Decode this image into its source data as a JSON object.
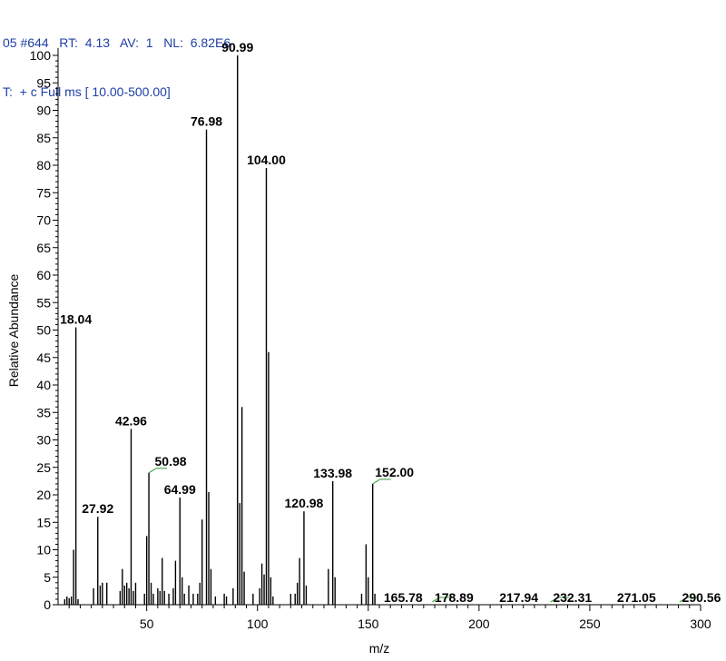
{
  "header": {
    "line1": "05 #644   RT:  4.13   AV:  1   NL:  6.82E6",
    "line2": "T:  + c Full ms [ 10.00-500.00]"
  },
  "colors": {
    "header_text": "#1f3fa6",
    "label_leader": "#2e9b2e",
    "axis": "#000000"
  },
  "chart_data": {
    "type": "bar",
    "xlabel": "m/z",
    "ylabel": "Relative Abundance",
    "xlim": [
      10,
      300
    ],
    "ylim": [
      0,
      100
    ],
    "x_ticks": [
      50,
      100,
      150,
      200,
      250,
      300
    ],
    "y_ticks": [
      0,
      5,
      10,
      15,
      20,
      25,
      30,
      35,
      40,
      45,
      50,
      55,
      60,
      65,
      70,
      75,
      80,
      85,
      90,
      95,
      100
    ],
    "peaks": [
      {
        "mz": 13.0,
        "value": 1.0
      },
      {
        "mz": 14.0,
        "value": 1.5
      },
      {
        "mz": 15.0,
        "value": 1.2
      },
      {
        "mz": 16.0,
        "value": 1.5
      },
      {
        "mz": 17.0,
        "value": 10.0
      },
      {
        "mz": 18.04,
        "value": 50.5
      },
      {
        "mz": 19.0,
        "value": 1.0
      },
      {
        "mz": 26.0,
        "value": 3.0
      },
      {
        "mz": 27.92,
        "value": 16.0
      },
      {
        "mz": 29.0,
        "value": 3.5
      },
      {
        "mz": 30.0,
        "value": 4.0
      },
      {
        "mz": 32.0,
        "value": 4.0
      },
      {
        "mz": 38.0,
        "value": 2.5
      },
      {
        "mz": 39.0,
        "value": 6.5
      },
      {
        "mz": 40.0,
        "value": 3.5
      },
      {
        "mz": 41.0,
        "value": 4.0
      },
      {
        "mz": 42.0,
        "value": 3.0
      },
      {
        "mz": 42.96,
        "value": 32.0
      },
      {
        "mz": 44.0,
        "value": 2.5
      },
      {
        "mz": 45.0,
        "value": 4.0
      },
      {
        "mz": 49.0,
        "value": 2.0
      },
      {
        "mz": 50.0,
        "value": 12.5
      },
      {
        "mz": 50.98,
        "value": 24.0
      },
      {
        "mz": 52.0,
        "value": 4.0
      },
      {
        "mz": 53.0,
        "value": 2.0
      },
      {
        "mz": 55.0,
        "value": 3.0
      },
      {
        "mz": 56.0,
        "value": 2.5
      },
      {
        "mz": 57.0,
        "value": 8.5
      },
      {
        "mz": 58.0,
        "value": 2.5
      },
      {
        "mz": 60.0,
        "value": 2.0
      },
      {
        "mz": 62.0,
        "value": 3.0
      },
      {
        "mz": 63.0,
        "value": 8.0
      },
      {
        "mz": 64.99,
        "value": 19.5
      },
      {
        "mz": 66.0,
        "value": 5.0
      },
      {
        "mz": 67.0,
        "value": 2.0
      },
      {
        "mz": 69.0,
        "value": 3.5
      },
      {
        "mz": 71.0,
        "value": 2.0
      },
      {
        "mz": 73.0,
        "value": 2.0
      },
      {
        "mz": 74.0,
        "value": 4.0
      },
      {
        "mz": 75.0,
        "value": 15.5
      },
      {
        "mz": 76.98,
        "value": 86.5
      },
      {
        "mz": 78.0,
        "value": 20.5
      },
      {
        "mz": 79.0,
        "value": 6.5
      },
      {
        "mz": 81.0,
        "value": 1.5
      },
      {
        "mz": 85.0,
        "value": 2.0
      },
      {
        "mz": 86.0,
        "value": 1.5
      },
      {
        "mz": 89.0,
        "value": 3.0
      },
      {
        "mz": 90.99,
        "value": 100.0
      },
      {
        "mz": 92.0,
        "value": 18.5
      },
      {
        "mz": 93.0,
        "value": 36.0
      },
      {
        "mz": 94.0,
        "value": 6.0
      },
      {
        "mz": 98.0,
        "value": 2.0
      },
      {
        "mz": 101.0,
        "value": 3.0
      },
      {
        "mz": 102.0,
        "value": 7.5
      },
      {
        "mz": 103.0,
        "value": 5.5
      },
      {
        "mz": 104.0,
        "value": 79.5
      },
      {
        "mz": 105.0,
        "value": 46.0
      },
      {
        "mz": 106.0,
        "value": 5.0
      },
      {
        "mz": 107.0,
        "value": 1.5
      },
      {
        "mz": 115.0,
        "value": 2.0
      },
      {
        "mz": 117.0,
        "value": 2.0
      },
      {
        "mz": 118.0,
        "value": 4.0
      },
      {
        "mz": 119.0,
        "value": 8.5
      },
      {
        "mz": 120.98,
        "value": 17.0
      },
      {
        "mz": 122.0,
        "value": 3.5
      },
      {
        "mz": 132.0,
        "value": 6.5
      },
      {
        "mz": 133.98,
        "value": 22.5
      },
      {
        "mz": 135.0,
        "value": 5.0
      },
      {
        "mz": 147.0,
        "value": 2.0
      },
      {
        "mz": 149.0,
        "value": 11.0
      },
      {
        "mz": 150.0,
        "value": 5.0
      },
      {
        "mz": 152.0,
        "value": 22.0
      },
      {
        "mz": 153.0,
        "value": 2.0
      }
    ],
    "labels": [
      {
        "mz": 18.04,
        "text": "18.04",
        "value": 50.5
      },
      {
        "mz": 27.92,
        "text": "27.92",
        "value": 16.0
      },
      {
        "mz": 42.96,
        "text": "42.96",
        "value": 32.0
      },
      {
        "mz": 50.98,
        "text": "50.98",
        "value": 24.0,
        "leader": true
      },
      {
        "mz": 64.99,
        "text": "64.99",
        "value": 19.5
      },
      {
        "mz": 76.98,
        "text": "76.98",
        "value": 86.5
      },
      {
        "mz": 90.99,
        "text": "90.99",
        "value": 100.0
      },
      {
        "mz": 104.0,
        "text": "104.00",
        "value": 79.5
      },
      {
        "mz": 120.98,
        "text": "120.98",
        "value": 17.0
      },
      {
        "mz": 133.98,
        "text": "133.98",
        "value": 22.5
      },
      {
        "mz": 152.0,
        "text": "152.00",
        "value": 22.0,
        "leader": true
      },
      {
        "mz": 165.78,
        "text": "165.78",
        "value": 0.5
      },
      {
        "mz": 178.89,
        "text": "178.89",
        "value": 0.5,
        "leader": true
      },
      {
        "mz": 217.94,
        "text": "217.94",
        "value": 0.5
      },
      {
        "mz": 232.31,
        "text": "232.31",
        "value": 0.5,
        "leader": true
      },
      {
        "mz": 271.05,
        "text": "271.05",
        "value": 0.5
      },
      {
        "mz": 290.56,
        "text": "290.56",
        "value": 0.5,
        "leader": true
      }
    ]
  }
}
